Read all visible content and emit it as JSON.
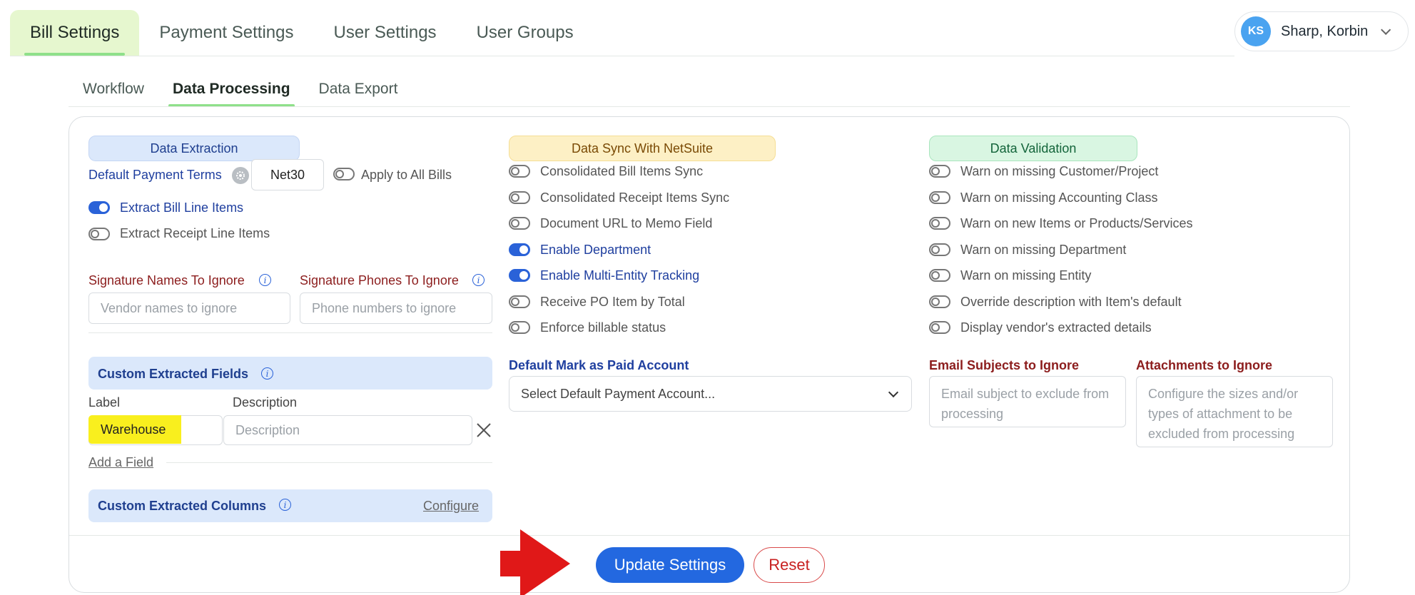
{
  "top_tabs": [
    "Bill Settings",
    "Payment Settings",
    "User Settings",
    "User Groups"
  ],
  "user": {
    "initials": "KS",
    "name": "Sharp, Korbin"
  },
  "sub_tabs": [
    "Workflow",
    "Data Processing",
    "Data Export"
  ],
  "extraction": {
    "title": "Data Extraction",
    "payment_terms_label": "Default Payment Terms",
    "payment_terms_value": "Net30",
    "apply_all_label": "Apply to All Bills",
    "extract_bill_lines": "Extract Bill Line Items",
    "extract_receipt_lines": "Extract Receipt Line Items",
    "sig_names_label": "Signature Names To Ignore",
    "sig_names_placeholder": "Vendor names to ignore",
    "sig_phones_label": "Signature Phones To Ignore",
    "sig_phones_placeholder": "Phone numbers to ignore",
    "custom_fields_title": "Custom Extracted Fields",
    "col_label": "Label",
    "col_description": "Description",
    "field_label_value": "Warehouse",
    "field_desc_placeholder": "Description",
    "add_field": "Add a Field",
    "custom_columns_title": "Custom Extracted Columns",
    "configure": "Configure"
  },
  "sync": {
    "title": "Data Sync With NetSuite",
    "options": [
      {
        "label": "Consolidated Bill Items Sync",
        "on": false
      },
      {
        "label": "Consolidated Receipt Items Sync",
        "on": false
      },
      {
        "label": "Document URL to Memo Field",
        "on": false
      },
      {
        "label": "Enable Department",
        "on": true
      },
      {
        "label": "Enable Multi-Entity Tracking",
        "on": true
      },
      {
        "label": "Receive PO Item by Total",
        "on": false
      },
      {
        "label": "Enforce billable status",
        "on": false
      }
    ],
    "paid_account_label": "Default Mark as Paid Account",
    "paid_account_placeholder": "Select Default Payment Account..."
  },
  "validation": {
    "title": "Data Validation",
    "options": [
      {
        "label": "Warn on missing Customer/Project",
        "on": false
      },
      {
        "label": "Warn on missing Accounting Class",
        "on": false
      },
      {
        "label": "Warn on new Items or Products/Services",
        "on": false
      },
      {
        "label": "Warn on missing Department",
        "on": false
      },
      {
        "label": "Warn on missing Entity",
        "on": false
      },
      {
        "label": "Override description with Item's default",
        "on": false
      },
      {
        "label": "Display vendor's extracted details",
        "on": false
      }
    ],
    "email_subjects_label": "Email Subjects to Ignore",
    "email_subjects_placeholder": "Email subject to exclude from processing",
    "attachments_label": "Attachments to Ignore",
    "attachments_placeholder": "Configure the sizes and/or types of attachment to be excluded from processing"
  },
  "footer": {
    "update": "Update Settings",
    "reset": "Reset"
  },
  "colors": {
    "primary": "#2368e0",
    "accent_green": "#8fe08a",
    "arrow_red": "#e01818"
  }
}
